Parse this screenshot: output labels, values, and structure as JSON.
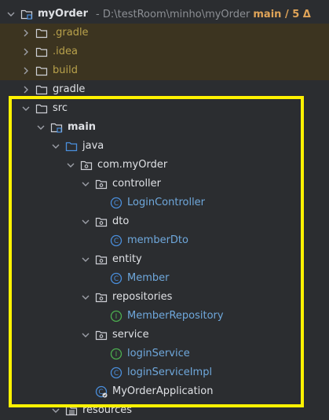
{
  "root": {
    "name": "myOrder",
    "path": "- D:\\testRoom\\minho\\myOrder",
    "vcs": "main / 5 Δ"
  },
  "nodes": [
    {
      "label": ".gradle",
      "style": "excluded",
      "icon": "folder-icon"
    },
    {
      "label": ".idea",
      "style": "excluded",
      "icon": "folder-icon"
    },
    {
      "label": "build",
      "style": "excluded",
      "icon": "folder-icon"
    },
    {
      "label": "gradle",
      "style": "default",
      "icon": "folder-icon"
    },
    {
      "label": "src",
      "style": "default",
      "icon": "folder-icon"
    },
    {
      "label": "main",
      "style": "bold",
      "icon": "module-folder-icon"
    },
    {
      "label": "java",
      "style": "default",
      "icon": "source-folder-icon"
    },
    {
      "label": "com.myOrder",
      "style": "default",
      "icon": "package-icon"
    },
    {
      "label": "controller",
      "style": "default",
      "icon": "package-icon"
    },
    {
      "label": "LoginController",
      "style": "class",
      "icon": "class-icon"
    },
    {
      "label": "dto",
      "style": "default",
      "icon": "package-icon"
    },
    {
      "label": "memberDto",
      "style": "class",
      "icon": "class-icon"
    },
    {
      "label": "entity",
      "style": "default",
      "icon": "package-icon"
    },
    {
      "label": "Member",
      "style": "class",
      "icon": "class-icon"
    },
    {
      "label": "repositories",
      "style": "default",
      "icon": "package-icon"
    },
    {
      "label": "MemberRepository",
      "style": "iface",
      "icon": "interface-icon"
    },
    {
      "label": "service",
      "style": "default",
      "icon": "package-icon"
    },
    {
      "label": "loginService",
      "style": "iface",
      "icon": "interface-icon"
    },
    {
      "label": "loginServiceImpl",
      "style": "class",
      "icon": "class-icon"
    },
    {
      "label": "MyOrderApplication",
      "style": "default",
      "icon": "spring-app-icon"
    },
    {
      "label": "resources",
      "style": "default",
      "icon": "resources-folder-icon"
    }
  ],
  "colors": {
    "background": "#2b2d30",
    "excluded_row": "#3c3420",
    "highlight": "#fff200",
    "class_icon": "#4a8fdd",
    "interface_icon": "#4caf50"
  }
}
